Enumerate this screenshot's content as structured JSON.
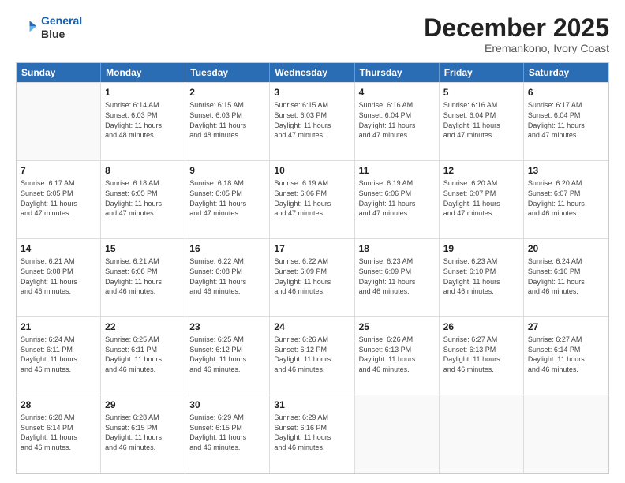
{
  "header": {
    "logo_line1": "General",
    "logo_line2": "Blue",
    "month": "December 2025",
    "location": "Eremankono, Ivory Coast"
  },
  "weekdays": [
    "Sunday",
    "Monday",
    "Tuesday",
    "Wednesday",
    "Thursday",
    "Friday",
    "Saturday"
  ],
  "rows": [
    [
      {
        "day": "",
        "info": "",
        "empty": true
      },
      {
        "day": "1",
        "info": "Sunrise: 6:14 AM\nSunset: 6:03 PM\nDaylight: 11 hours\nand 48 minutes.",
        "empty": false
      },
      {
        "day": "2",
        "info": "Sunrise: 6:15 AM\nSunset: 6:03 PM\nDaylight: 11 hours\nand 48 minutes.",
        "empty": false
      },
      {
        "day": "3",
        "info": "Sunrise: 6:15 AM\nSunset: 6:03 PM\nDaylight: 11 hours\nand 47 minutes.",
        "empty": false
      },
      {
        "day": "4",
        "info": "Sunrise: 6:16 AM\nSunset: 6:04 PM\nDaylight: 11 hours\nand 47 minutes.",
        "empty": false
      },
      {
        "day": "5",
        "info": "Sunrise: 6:16 AM\nSunset: 6:04 PM\nDaylight: 11 hours\nand 47 minutes.",
        "empty": false
      },
      {
        "day": "6",
        "info": "Sunrise: 6:17 AM\nSunset: 6:04 PM\nDaylight: 11 hours\nand 47 minutes.",
        "empty": false
      }
    ],
    [
      {
        "day": "7",
        "info": "Sunrise: 6:17 AM\nSunset: 6:05 PM\nDaylight: 11 hours\nand 47 minutes.",
        "empty": false
      },
      {
        "day": "8",
        "info": "Sunrise: 6:18 AM\nSunset: 6:05 PM\nDaylight: 11 hours\nand 47 minutes.",
        "empty": false
      },
      {
        "day": "9",
        "info": "Sunrise: 6:18 AM\nSunset: 6:05 PM\nDaylight: 11 hours\nand 47 minutes.",
        "empty": false
      },
      {
        "day": "10",
        "info": "Sunrise: 6:19 AM\nSunset: 6:06 PM\nDaylight: 11 hours\nand 47 minutes.",
        "empty": false
      },
      {
        "day": "11",
        "info": "Sunrise: 6:19 AM\nSunset: 6:06 PM\nDaylight: 11 hours\nand 47 minutes.",
        "empty": false
      },
      {
        "day": "12",
        "info": "Sunrise: 6:20 AM\nSunset: 6:07 PM\nDaylight: 11 hours\nand 47 minutes.",
        "empty": false
      },
      {
        "day": "13",
        "info": "Sunrise: 6:20 AM\nSunset: 6:07 PM\nDaylight: 11 hours\nand 46 minutes.",
        "empty": false
      }
    ],
    [
      {
        "day": "14",
        "info": "Sunrise: 6:21 AM\nSunset: 6:08 PM\nDaylight: 11 hours\nand 46 minutes.",
        "empty": false
      },
      {
        "day": "15",
        "info": "Sunrise: 6:21 AM\nSunset: 6:08 PM\nDaylight: 11 hours\nand 46 minutes.",
        "empty": false
      },
      {
        "day": "16",
        "info": "Sunrise: 6:22 AM\nSunset: 6:08 PM\nDaylight: 11 hours\nand 46 minutes.",
        "empty": false
      },
      {
        "day": "17",
        "info": "Sunrise: 6:22 AM\nSunset: 6:09 PM\nDaylight: 11 hours\nand 46 minutes.",
        "empty": false
      },
      {
        "day": "18",
        "info": "Sunrise: 6:23 AM\nSunset: 6:09 PM\nDaylight: 11 hours\nand 46 minutes.",
        "empty": false
      },
      {
        "day": "19",
        "info": "Sunrise: 6:23 AM\nSunset: 6:10 PM\nDaylight: 11 hours\nand 46 minutes.",
        "empty": false
      },
      {
        "day": "20",
        "info": "Sunrise: 6:24 AM\nSunset: 6:10 PM\nDaylight: 11 hours\nand 46 minutes.",
        "empty": false
      }
    ],
    [
      {
        "day": "21",
        "info": "Sunrise: 6:24 AM\nSunset: 6:11 PM\nDaylight: 11 hours\nand 46 minutes.",
        "empty": false
      },
      {
        "day": "22",
        "info": "Sunrise: 6:25 AM\nSunset: 6:11 PM\nDaylight: 11 hours\nand 46 minutes.",
        "empty": false
      },
      {
        "day": "23",
        "info": "Sunrise: 6:25 AM\nSunset: 6:12 PM\nDaylight: 11 hours\nand 46 minutes.",
        "empty": false
      },
      {
        "day": "24",
        "info": "Sunrise: 6:26 AM\nSunset: 6:12 PM\nDaylight: 11 hours\nand 46 minutes.",
        "empty": false
      },
      {
        "day": "25",
        "info": "Sunrise: 6:26 AM\nSunset: 6:13 PM\nDaylight: 11 hours\nand 46 minutes.",
        "empty": false
      },
      {
        "day": "26",
        "info": "Sunrise: 6:27 AM\nSunset: 6:13 PM\nDaylight: 11 hours\nand 46 minutes.",
        "empty": false
      },
      {
        "day": "27",
        "info": "Sunrise: 6:27 AM\nSunset: 6:14 PM\nDaylight: 11 hours\nand 46 minutes.",
        "empty": false
      }
    ],
    [
      {
        "day": "28",
        "info": "Sunrise: 6:28 AM\nSunset: 6:14 PM\nDaylight: 11 hours\nand 46 minutes.",
        "empty": false
      },
      {
        "day": "29",
        "info": "Sunrise: 6:28 AM\nSunset: 6:15 PM\nDaylight: 11 hours\nand 46 minutes.",
        "empty": false
      },
      {
        "day": "30",
        "info": "Sunrise: 6:29 AM\nSunset: 6:15 PM\nDaylight: 11 hours\nand 46 minutes.",
        "empty": false
      },
      {
        "day": "31",
        "info": "Sunrise: 6:29 AM\nSunset: 6:16 PM\nDaylight: 11 hours\nand 46 minutes.",
        "empty": false
      },
      {
        "day": "",
        "info": "",
        "empty": true
      },
      {
        "day": "",
        "info": "",
        "empty": true
      },
      {
        "day": "",
        "info": "",
        "empty": true
      }
    ]
  ]
}
